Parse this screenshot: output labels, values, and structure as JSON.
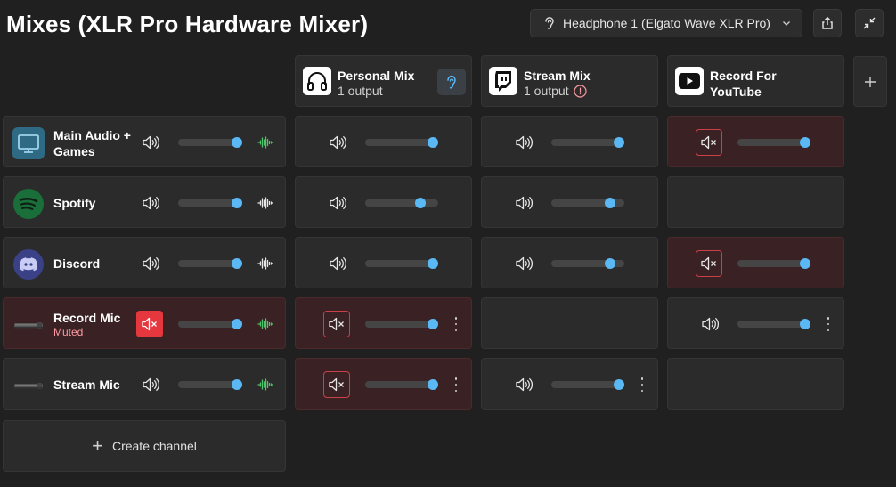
{
  "page": {
    "title": "Mixes (XLR Pro Hardware Mixer)"
  },
  "monitor_output": {
    "label": "Headphone 1 (Elgato Wave XLR Pro)"
  },
  "toolbar": {
    "share_icon": "export-icon",
    "collapse_icon": "collapse-icon"
  },
  "mixes": [
    {
      "name": "Personal Mix",
      "sub": "1 output",
      "logo": "headphones-icon",
      "listening": true
    },
    {
      "name": "Stream Mix",
      "sub": "1 output",
      "logo": "twitch-icon",
      "warning": true
    },
    {
      "name": "Record For YouTube",
      "sub": "",
      "logo": "youtube-icon"
    }
  ],
  "channels": [
    {
      "name": "Main Audio + Games",
      "sub": "",
      "icon": "monitor-icon",
      "local": {
        "muted": false,
        "level": 1.0,
        "wave": "green"
      },
      "mixes": [
        {
          "muted": false,
          "level": 1.0
        },
        {
          "muted": false,
          "level": 1.0
        },
        {
          "muted": true,
          "level": 1.0
        }
      ]
    },
    {
      "name": "Spotify",
      "sub": "",
      "icon": "spotify-icon",
      "local": {
        "muted": false,
        "level": 1.0,
        "wave": "white"
      },
      "mixes": [
        {
          "muted": false,
          "level": 0.8
        },
        {
          "muted": false,
          "level": 0.85
        },
        {
          "empty": true
        }
      ]
    },
    {
      "name": "Discord",
      "sub": "",
      "icon": "discord-icon",
      "local": {
        "muted": false,
        "level": 1.0,
        "wave": "white"
      },
      "mixes": [
        {
          "muted": false,
          "level": 1.0
        },
        {
          "muted": false,
          "level": 0.85
        },
        {
          "muted": true,
          "level": 1.0
        }
      ]
    },
    {
      "name": "Record Mic",
      "sub": "Muted",
      "icon": "microphone-icon",
      "local": {
        "muted": true,
        "level": 1.0,
        "wave": "green"
      },
      "mixes": [
        {
          "muted": true,
          "level": 1.0,
          "more": true
        },
        {
          "empty": true
        },
        {
          "muted": false,
          "level": 1.0,
          "more": true
        }
      ]
    },
    {
      "name": "Stream Mic",
      "sub": "",
      "icon": "microphone-icon",
      "local": {
        "muted": false,
        "level": 1.0,
        "wave": "green"
      },
      "mixes": [
        {
          "muted": true,
          "level": 1.0,
          "more": true
        },
        {
          "muted": false,
          "level": 1.0,
          "more": true
        },
        {
          "empty": true
        }
      ]
    }
  ],
  "create_channel": {
    "label": "Create channel"
  },
  "colors": {
    "accent": "#5ab8f5",
    "mute_red": "#e5373e",
    "wave_green": "#4fc26a"
  }
}
